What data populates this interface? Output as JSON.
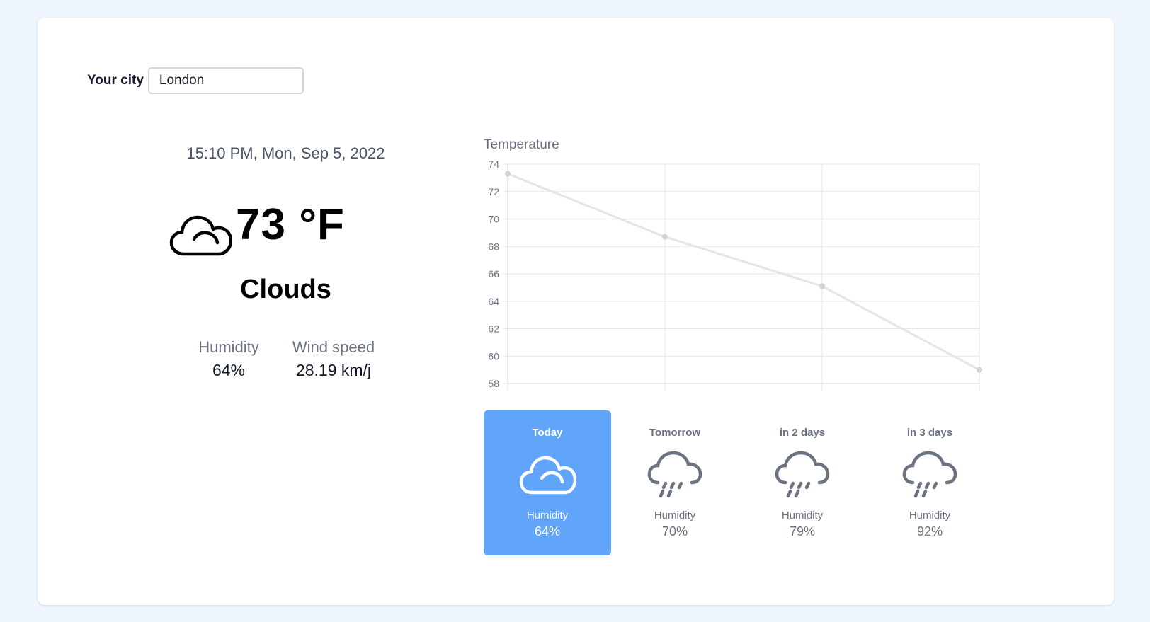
{
  "search": {
    "label": "Your city",
    "value": "London"
  },
  "current": {
    "datetime": "15:10 PM, Mon, Sep 5, 2022",
    "temperature": "73 °F",
    "condition": "Clouds",
    "condition_icon": "cloud-icon",
    "humidity_label": "Humidity",
    "humidity_value": "64%",
    "wind_label": "Wind speed",
    "wind_value": "28.19 km/j"
  },
  "chart_data": {
    "type": "line",
    "title": "Temperature",
    "x": [
      "Today",
      "Tomorrow",
      "in 2 days",
      "in 3 days"
    ],
    "series": [
      {
        "values": [
          73.3,
          68.7,
          65.1,
          59.0
        ]
      }
    ],
    "ylim": [
      58,
      74
    ],
    "yticks": [
      74,
      72,
      70,
      68,
      66,
      64,
      62,
      60,
      58
    ],
    "grid": true,
    "line_color": "#e5e5e5"
  },
  "forecast": [
    {
      "day": "Today",
      "icon": "cloud-icon",
      "humidity_label": "Humidity",
      "humidity": "64%",
      "active": true
    },
    {
      "day": "Tomorrow",
      "icon": "rain-icon",
      "humidity_label": "Humidity",
      "humidity": "70%",
      "active": false
    },
    {
      "day": "in 2 days",
      "icon": "rain-icon",
      "humidity_label": "Humidity",
      "humidity": "79%",
      "active": false
    },
    {
      "day": "in 3 days",
      "icon": "rain-icon",
      "humidity_label": "Humidity",
      "humidity": "92%",
      "active": false
    }
  ],
  "colors": {
    "accent": "#60a5fa",
    "background": "#eff6ff",
    "muted": "#6b7280"
  }
}
